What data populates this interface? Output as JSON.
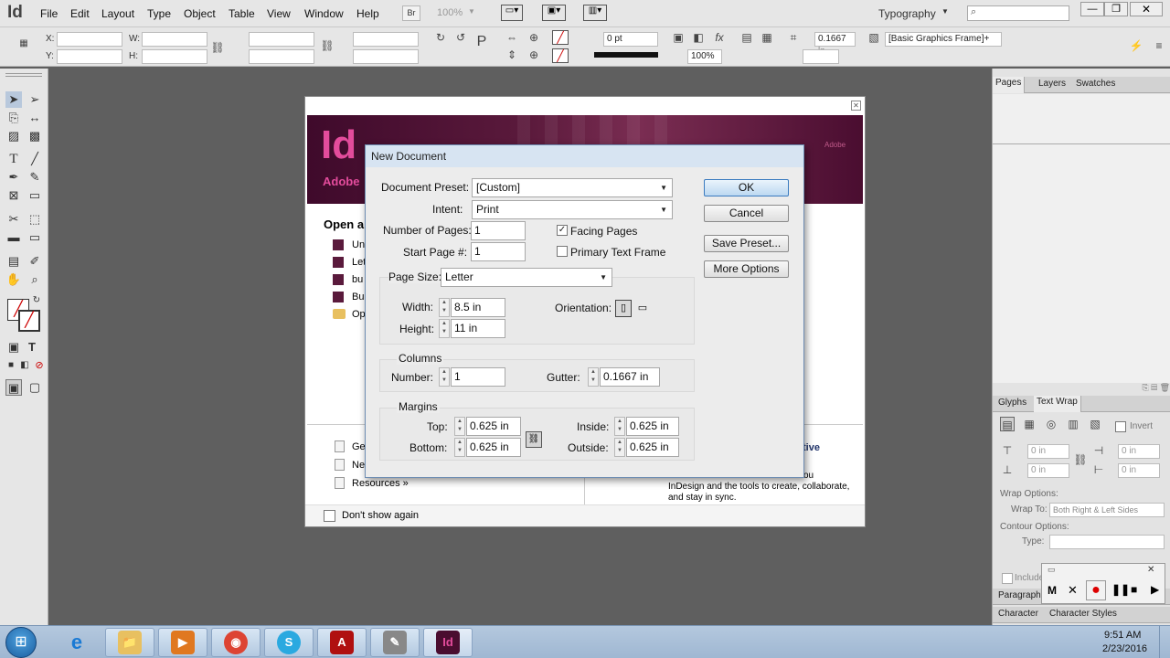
{
  "app": {
    "logo": "Id",
    "zoom": "100%",
    "workspace": "Typography",
    "search_placeholder": ""
  },
  "menu": [
    "File",
    "Edit",
    "Layout",
    "Type",
    "Object",
    "Table",
    "View",
    "Window",
    "Help"
  ],
  "bridge_label": "Br",
  "control": {
    "x_label": "X:",
    "y_label": "Y:",
    "w_label": "W:",
    "h_label": "H:",
    "stroke_weight": "0 pt",
    "scale": "100%",
    "gutter_val": "0.1667 in",
    "object_style": "[Basic Graphics Frame]+"
  },
  "panels": {
    "top_tabs": [
      "Pages",
      "Layers",
      "Swatches"
    ],
    "mid_tabs": [
      "Glyphs",
      "Text Wrap"
    ],
    "invert": "Invert",
    "offsets": [
      "0 in",
      "0 in",
      "0 in",
      "0 in"
    ],
    "wrap_options": "Wrap Options:",
    "wrap_to_label": "Wrap To:",
    "wrap_to_value": "Both Right & Left Sides",
    "contour_options": "Contour Options:",
    "type_label": "Type:",
    "include": "Include",
    "bottom_tabs": [
      "Paragraph",
      "Character",
      "Character Styles"
    ]
  },
  "welcome": {
    "banner_logo": "Id",
    "banner_text": "Adobe",
    "banner_adobe": "Adobe",
    "open_heading": "Open a",
    "recent": [
      "Un",
      "Let",
      "bu",
      "Bu",
      "Op"
    ],
    "bottom_links": [
      "Get",
      "Ne",
      "Resources »"
    ],
    "right_heading": "tive",
    "right_text": [
      "ou",
      "InDesign and the tools to create, collaborate,",
      "and stay in sync."
    ],
    "dont_show": "Don't show again"
  },
  "dialog": {
    "title": "New Document",
    "preset_label": "Document Preset:",
    "preset_value": "[Custom]",
    "intent_label": "Intent:",
    "intent_value": "Print",
    "pages_label": "Number of Pages:",
    "pages_value": "1",
    "start_label": "Start Page #:",
    "start_value": "1",
    "facing_label": "Facing Pages",
    "facing_checked": true,
    "ptf_label": "Primary Text Frame",
    "ptf_checked": false,
    "pagesize_label": "Page Size:",
    "pagesize_value": "Letter",
    "width_label": "Width:",
    "width_value": "8.5 in",
    "height_label": "Height:",
    "height_value": "11 in",
    "orientation_label": "Orientation:",
    "columns_heading": "Columns",
    "number_label": "Number:",
    "number_value": "1",
    "gutter_label": "Gutter:",
    "gutter_value": "0.1667 in",
    "margins_heading": "Margins",
    "top_label": "Top:",
    "top_value": "0.625 in",
    "bottom_label": "Bottom:",
    "bottom_value": "0.625 in",
    "inside_label": "Inside:",
    "inside_value": "0.625 in",
    "outside_label": "Outside:",
    "outside_value": "0.625 in",
    "ok": "OK",
    "cancel": "Cancel",
    "save_preset": "Save Preset...",
    "more_options": "More Options"
  },
  "taskbar": {
    "time": "9:51 AM",
    "date": "2/23/2016",
    "apps": [
      "e",
      "📁",
      "▶",
      "◉",
      "S",
      "A",
      "✎",
      "Id"
    ]
  },
  "recorder": {
    "m": "M"
  }
}
